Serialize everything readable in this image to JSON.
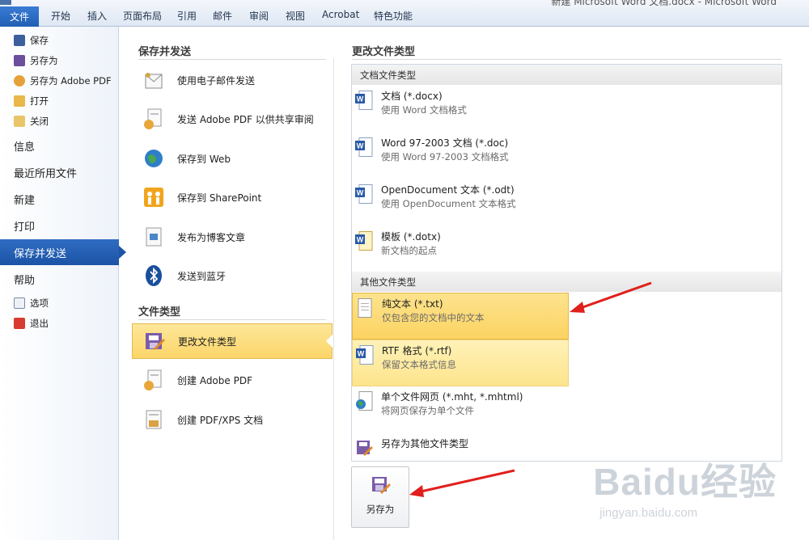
{
  "titlebar": {
    "fragment": "新建 Microsoft Word 文档.docx - Microsoft Word"
  },
  "ribbon": {
    "file_tab": "文件",
    "tabs": [
      "开始",
      "插入",
      "页面布局",
      "引用",
      "邮件",
      "审阅",
      "视图",
      "Acrobat",
      "特色功能"
    ]
  },
  "leftnav": {
    "commands": [
      {
        "label": "保存",
        "icon": "save-icon"
      },
      {
        "label": "另存为",
        "icon": "save-as-icon"
      },
      {
        "label": "另存为 Adobe PDF",
        "icon": "pdf-icon"
      },
      {
        "label": "打开",
        "icon": "open-folder-icon"
      },
      {
        "label": "关闭",
        "icon": "close-folder-icon"
      }
    ],
    "tabs": [
      "信息",
      "最近所用文件",
      "新建",
      "打印",
      "保存并发送",
      "帮助"
    ],
    "selected_tab": "保存并发送",
    "bottom": [
      {
        "label": "选项",
        "icon": "options-icon"
      },
      {
        "label": "退出",
        "icon": "exit-icon"
      }
    ]
  },
  "middle": {
    "heading_send": "保存并发送",
    "send_items": [
      {
        "label": "使用电子邮件发送",
        "icon": "email-icon"
      },
      {
        "label": "发送 Adobe PDF 以供共享审阅",
        "icon": "pdf-share-icon"
      },
      {
        "label": "保存到 Web",
        "icon": "globe-icon"
      },
      {
        "label": "保存到 SharePoint",
        "icon": "sharepoint-icon"
      },
      {
        "label": "发布为博客文章",
        "icon": "blog-icon"
      },
      {
        "label": "发送到蓝牙",
        "icon": "bluetooth-icon"
      }
    ],
    "heading_types": "文件类型",
    "type_items": [
      {
        "label": "更改文件类型",
        "icon": "change-type-icon"
      },
      {
        "label": "创建 Adobe PDF",
        "icon": "create-pdf-icon"
      },
      {
        "label": "创建 PDF/XPS 文档",
        "icon": "xps-icon"
      }
    ],
    "selected_item": "更改文件类型"
  },
  "right": {
    "heading": "更改文件类型",
    "group_doc": "文档文件类型",
    "doc_types": [
      {
        "name": "文档 (*.docx)",
        "desc": "使用 Word 文档格式"
      },
      {
        "name": "Word 97-2003 文档 (*.doc)",
        "desc": "使用 Word 97-2003 文档格式"
      },
      {
        "name": "OpenDocument 文本 (*.odt)",
        "desc": "使用 OpenDocument 文本格式"
      },
      {
        "name": "模板 (*.dotx)",
        "desc": "新文档的起点"
      }
    ],
    "group_other": "其他文件类型",
    "other_types": [
      {
        "name": "纯文本 (*.txt)",
        "desc": "仅包含您的文档中的文本"
      },
      {
        "name": "RTF 格式 (*.rtf)",
        "desc": "保留文本格式信息"
      },
      {
        "name": "单个文件网页 (*.mht, *.mhtml)",
        "desc": "将网页保存为单个文件"
      },
      {
        "name": "另存为其他文件类型",
        "desc": ""
      }
    ],
    "saveas_button": "另存为"
  },
  "watermark": {
    "brand": "Baidu经验",
    "url": "jingyan.baidu.com"
  },
  "colors": {
    "accent_blue": "#1f5fb4",
    "highlight_yellow": "#fcd361",
    "arrow_red": "#e0201c"
  }
}
